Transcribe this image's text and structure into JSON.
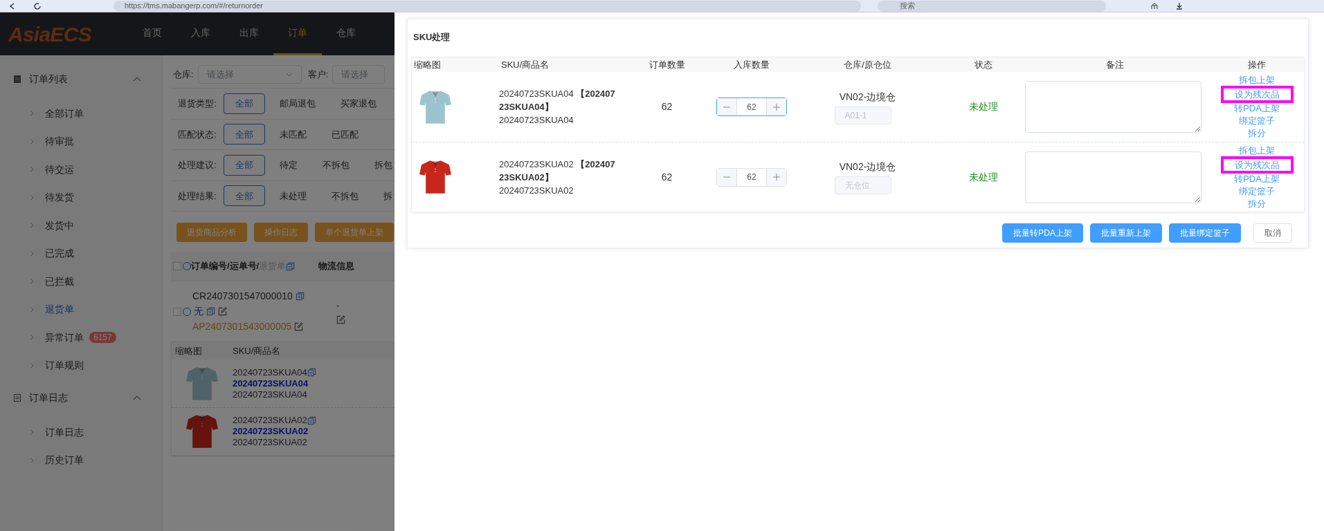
{
  "browser": {
    "url": "https://tms.mabangerp.com/#/returnorder",
    "search_placeholder": "搜索"
  },
  "nav": {
    "logo": "AsiaECS",
    "items": [
      {
        "label": "首页",
        "selected": false
      },
      {
        "label": "入库",
        "selected": false
      },
      {
        "label": "出库",
        "selected": false
      },
      {
        "label": "订单",
        "selected": true
      },
      {
        "label": "仓库",
        "selected": false
      }
    ]
  },
  "sidebar": {
    "groups": [
      {
        "title": "订单列表",
        "expanded": true,
        "items": [
          {
            "label": "全部订单",
            "selected": false
          },
          {
            "label": "待审批",
            "selected": false
          },
          {
            "label": "待交运",
            "selected": false
          },
          {
            "label": "待发货",
            "selected": false
          },
          {
            "label": "发货中",
            "selected": false
          },
          {
            "label": "已完成",
            "selected": false
          },
          {
            "label": "已拦截",
            "selected": false
          },
          {
            "label": "退货单",
            "selected": true
          },
          {
            "label": "异常订单",
            "selected": false,
            "badge": "6157"
          },
          {
            "label": "订单规则",
            "selected": false
          }
        ]
      },
      {
        "title": "订单日志",
        "expanded": true,
        "items": [
          {
            "label": "订单日志",
            "selected": false
          },
          {
            "label": "历史订单",
            "selected": false
          }
        ]
      }
    ]
  },
  "filters": {
    "selects": [
      {
        "label": "仓库:",
        "placeholder": "请选择"
      },
      {
        "label": "客户:",
        "placeholder": "请选择"
      }
    ],
    "rows": [
      {
        "label": "退货类型:",
        "options": [
          {
            "label": "全部",
            "selected": true
          },
          {
            "label": "邮局退包",
            "selected": false
          },
          {
            "label": "买家退包",
            "selected": false
          }
        ]
      },
      {
        "label": "匹配状态:",
        "options": [
          {
            "label": "全部",
            "selected": true
          },
          {
            "label": "未匹配",
            "selected": false
          },
          {
            "label": "已匹配",
            "selected": false
          }
        ]
      },
      {
        "label": "处理建议:",
        "options": [
          {
            "label": "全部",
            "selected": true
          },
          {
            "label": "待定",
            "selected": false
          },
          {
            "label": "不拆包",
            "selected": false
          },
          {
            "label": "拆包",
            "selected": false
          }
        ]
      },
      {
        "label": "处理结果:",
        "options": [
          {
            "label": "全部",
            "selected": true
          },
          {
            "label": "未处理",
            "selected": false
          },
          {
            "label": "不拆包",
            "selected": false
          },
          {
            "label": "拆",
            "selected": false
          }
        ]
      }
    ]
  },
  "actions": [
    "退货商品分析",
    "操作日志",
    "单个退货单上架"
  ],
  "orders_table": {
    "columns": [
      "订单编号/运单号/",
      "退货单",
      "物流信息"
    ],
    "checked": false,
    "rows": [
      {
        "checked": false,
        "order_no": "CR2407301547000010",
        "tracking": "无",
        "return_no": "AP2407301543000005",
        "logistics": "-"
      }
    ],
    "sku_table": {
      "columns": [
        "缩略图",
        "SKU/商品名"
      ],
      "rows": [
        {
          "sku": "20240723SKUA04",
          "name": "20240723SKUA04",
          "code": "20240723SKUA04"
        },
        {
          "sku": "20240723SKUA02",
          "name": "20240723SKUA02",
          "code": "20240723SKUA02"
        }
      ]
    }
  },
  "modal": {
    "title": "SKU处理",
    "columns": [
      "缩略图",
      "SKU/商品名",
      "订单数量",
      "入库数量",
      "仓库/原仓位",
      "状态",
      "备注",
      "操作"
    ],
    "rows": [
      {
        "color": "#9cc4cf",
        "sku": "20240723SKUA04 **【20240723SKUA04】**",
        "name": "20240723SKUA04",
        "order_qty": "62",
        "inbound_qty": "62",
        "focused": true,
        "warehouse": "VN02-边境仓",
        "location": "A01-1",
        "status": "未处理",
        "actions": [
          {
            "label": "拆包上架",
            "highlighted": false
          },
          {
            "label": "设为残次品",
            "highlighted": true
          },
          {
            "label": "转PDA上架",
            "highlighted": false
          },
          {
            "label": "绑定篮子",
            "highlighted": false
          },
          {
            "label": "拆分",
            "highlighted": false
          }
        ]
      },
      {
        "color": "#c8261b",
        "sku": "20240723SKUA02 **【20240723SKUA02】**",
        "name": "20240723SKUA02",
        "order_qty": "62",
        "inbound_qty": "62",
        "focused": false,
        "warehouse": "VN02-边境仓",
        "location_placeholder": "无仓位",
        "status": "未处理",
        "actions": [
          {
            "label": "拆包上架",
            "highlighted": false
          },
          {
            "label": "设为残次品",
            "highlighted": true
          },
          {
            "label": "转PDA上架",
            "highlighted": false
          },
          {
            "label": "绑定篮子",
            "highlighted": false
          },
          {
            "label": "拆分",
            "highlighted": false
          }
        ]
      }
    ],
    "buttons": [
      {
        "label": "批量转PDA上架",
        "kind": "primary"
      },
      {
        "label": "批量重新上架",
        "kind": "primary"
      },
      {
        "label": "批量绑定篮子",
        "kind": "primary"
      },
      {
        "label": "取消",
        "kind": "default"
      }
    ]
  }
}
